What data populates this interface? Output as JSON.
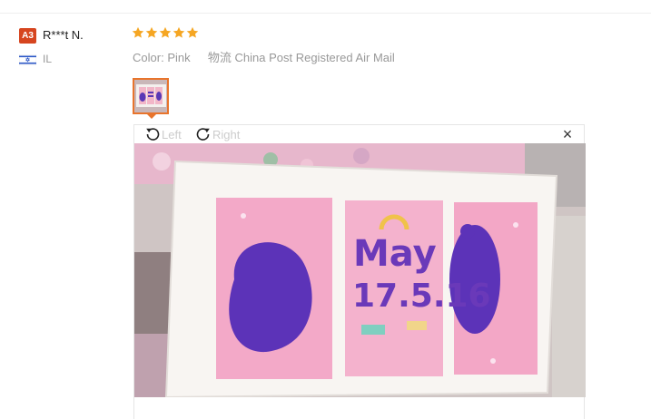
{
  "review": {
    "buyer": {
      "level_badge": "A3",
      "name": "R***t N.",
      "country": "IL",
      "flag_icon": "israel-flag-icon"
    },
    "rating": 5,
    "star_color": "#f5a623",
    "attributes": {
      "color_label": "Color:",
      "color_value": "Pink",
      "shipping_label": "物流",
      "shipping_value": "China Post Registered Air Mail"
    },
    "accent_color": "#e8742c",
    "viewer": {
      "rotate_left_label": "Left",
      "rotate_right_label": "Right",
      "close_icon": "close-icon",
      "photo_text_line1": "May",
      "photo_text_line2": "17.5.16"
    }
  }
}
